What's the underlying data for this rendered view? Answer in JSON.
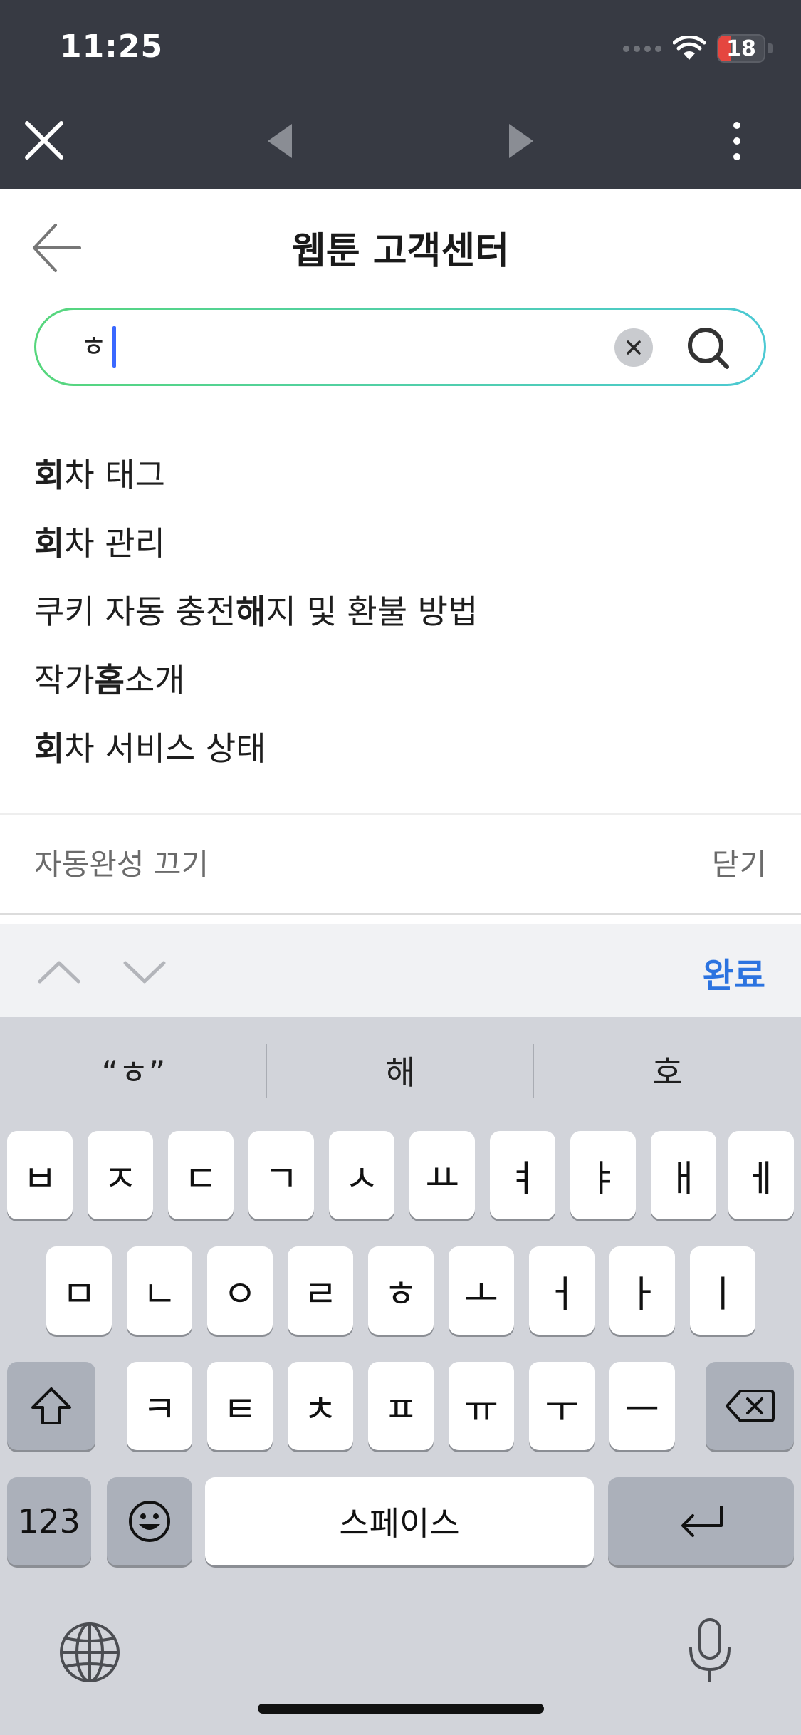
{
  "status_bar": {
    "time": "11:25",
    "battery": "18",
    "battery_level": 0.18
  },
  "page": {
    "title": "웹툰 고객센터"
  },
  "search": {
    "value": "ㅎ"
  },
  "suggestions": [
    {
      "bold": "회",
      "rest": "차 태그"
    },
    {
      "bold": "회",
      "rest": "차 관리"
    },
    {
      "before": "쿠키 자동 충전 ",
      "bold": "해",
      "rest": "지 및 환불 방법"
    },
    {
      "before": "작가 ",
      "bold": "홈",
      "rest": " 소개"
    },
    {
      "bold": "회",
      "rest": "차 서비스 상태"
    }
  ],
  "autocomplete": {
    "off_label": "자동완성 끄기",
    "close_label": "닫기"
  },
  "accessory": {
    "done_label": "완료"
  },
  "predictions": [
    "“ㅎ”",
    "해",
    "호"
  ],
  "keyboard": {
    "row1": [
      "ㅂ",
      "ㅈ",
      "ㄷ",
      "ㄱ",
      "ㅅ",
      "ㅛ",
      "ㅕ",
      "ㅑ",
      "ㅐ",
      "ㅔ"
    ],
    "row2": [
      "ㅁ",
      "ㄴ",
      "ㅇ",
      "ㄹ",
      "ㅎ",
      "ㅗ",
      "ㅓ",
      "ㅏ",
      "ㅣ"
    ],
    "row3": [
      "ㅋ",
      "ㅌ",
      "ㅊ",
      "ㅍ",
      "ㅠ",
      "ㅜ",
      "ㅡ"
    ],
    "numbers_label": "123",
    "space_label": "스페이스"
  }
}
